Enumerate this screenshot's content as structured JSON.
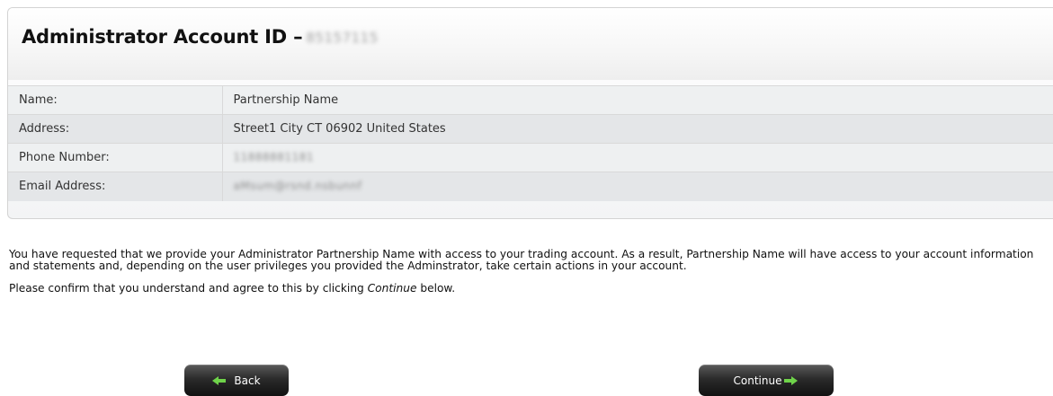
{
  "header": {
    "title": "Administrator Account ID –",
    "account_id": "85157115"
  },
  "details": {
    "rows": [
      {
        "label": "Name:",
        "value": "Partnership Name"
      },
      {
        "label": "Address:",
        "value": "Street1 City CT 06902 United States"
      },
      {
        "label": "Phone Number:",
        "value": "11888881181"
      },
      {
        "label": "Email Address:",
        "value": "aMsum@rsnd.nsbunnf"
      }
    ]
  },
  "message": {
    "paragraph1": "You have requested that we provide your Administrator Partnership Name with access to your trading account. As a result, Partnership Name will have access to your account information and statements and, depending on the user privileges you provided the Adminstrator, take certain actions in your account.",
    "confirm_before": "Please confirm that you understand and agree to this by clicking ",
    "confirm_emphasis": "Continue",
    "confirm_after": " below."
  },
  "buttons": {
    "back_label": "Back",
    "continue_label": "Continue"
  },
  "icons": {
    "back": "arrow-left-icon",
    "continue": "arrow-right-icon"
  },
  "colors": {
    "button_bg": "#1e1e1e",
    "arrow": "#6fd34a"
  }
}
